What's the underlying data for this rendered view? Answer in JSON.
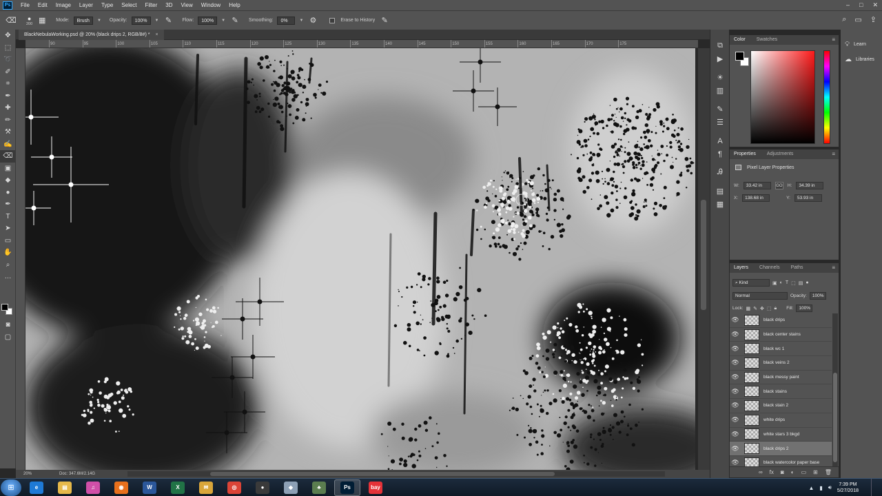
{
  "menubar": {
    "logo": "Ps",
    "items": [
      "File",
      "Edit",
      "Image",
      "Layer",
      "Type",
      "Select",
      "Filter",
      "3D",
      "View",
      "Window",
      "Help"
    ],
    "window_controls": [
      "–",
      "□",
      "✕"
    ]
  },
  "options_bar": {
    "brush_size": "200",
    "mode_label": "Mode:",
    "mode_value": "Brush",
    "opacity_label": "Opacity:",
    "opacity_value": "100%",
    "flow_label": "Flow:",
    "flow_value": "100%",
    "smoothing_label": "Smoothing:",
    "smoothing_value": "0%",
    "erase_history_label": "Erase to History"
  },
  "document": {
    "tab_title": "BlackNebulaWorking.psd @ 20% (black drips 2, RGB/8#) *",
    "tab_close": "×",
    "zoom": "20%",
    "doc_size": "Doc: 347.6M/2.14G",
    "ruler_ticks": [
      "90",
      "95",
      "100",
      "105",
      "110",
      "115",
      "120",
      "125",
      "130",
      "135",
      "140",
      "145",
      "150",
      "155",
      "160",
      "165",
      "170",
      "175"
    ]
  },
  "color_panel": {
    "tabs": [
      "Color",
      "Swatches"
    ],
    "foreground": "#000000",
    "background": "#ffffff"
  },
  "properties_panel": {
    "tabs": [
      "Properties",
      "Adjustments"
    ],
    "title": "Pixel Layer Properties",
    "w_label": "W:",
    "w_value": "33.42 in",
    "h_label": "H:",
    "h_value": "34.39 in",
    "x_label": "X:",
    "x_value": "138.68 in",
    "y_label": "Y:",
    "y_value": "53.93 in",
    "link_label": "GO"
  },
  "layers_panel": {
    "tabs": [
      "Layers",
      "Channels",
      "Paths"
    ],
    "filter_label": "Kind",
    "blend_mode": "Normal",
    "opacity_label": "Opacity:",
    "opacity_value": "100%",
    "lock_label": "Lock:",
    "fill_label": "Fill:",
    "fill_value": "100%",
    "layers": [
      {
        "name": "black drips",
        "selected": false
      },
      {
        "name": "black center stains",
        "selected": false
      },
      {
        "name": "black wc 1",
        "selected": false
      },
      {
        "name": "black veins 2",
        "selected": false
      },
      {
        "name": "black messy paint",
        "selected": false
      },
      {
        "name": "black stains",
        "selected": false
      },
      {
        "name": "black stain 2",
        "selected": false
      },
      {
        "name": "white drips",
        "selected": false
      },
      {
        "name": "white stars 3 bkgd",
        "selected": false
      },
      {
        "name": "black drips 2",
        "selected": true
      },
      {
        "name": "black watercolor paper base",
        "selected": false
      }
    ]
  },
  "right_dock": {
    "learn_label": "Learn",
    "libraries_label": "Libraries"
  },
  "taskbar": {
    "time": "7:39 PM",
    "date": "5/27/2018",
    "apps": [
      {
        "id": "ie",
        "glyph": "e",
        "color": "#1e7ad6"
      },
      {
        "id": "explorer",
        "glyph": "▤",
        "color": "#e6b94a"
      },
      {
        "id": "itunes",
        "glyph": "♫",
        "color": "#d04fa8"
      },
      {
        "id": "firefox",
        "glyph": "◉",
        "color": "#e8701c"
      },
      {
        "id": "word",
        "glyph": "W",
        "color": "#2b579a"
      },
      {
        "id": "excel",
        "glyph": "X",
        "color": "#217346"
      },
      {
        "id": "mail",
        "glyph": "✉",
        "color": "#d9a63a"
      },
      {
        "id": "chrome",
        "glyph": "◎",
        "color": "#db4437"
      },
      {
        "id": "obs",
        "glyph": "●",
        "color": "#3a3a3a"
      },
      {
        "id": "app-a",
        "glyph": "◆",
        "color": "#8da0b5"
      },
      {
        "id": "app-b",
        "glyph": "♣",
        "color": "#5b7d4f"
      },
      {
        "id": "photoshop",
        "glyph": "Ps",
        "color": "#001d34"
      },
      {
        "id": "ebay",
        "glyph": "bay",
        "color": "#e53238"
      }
    ]
  }
}
